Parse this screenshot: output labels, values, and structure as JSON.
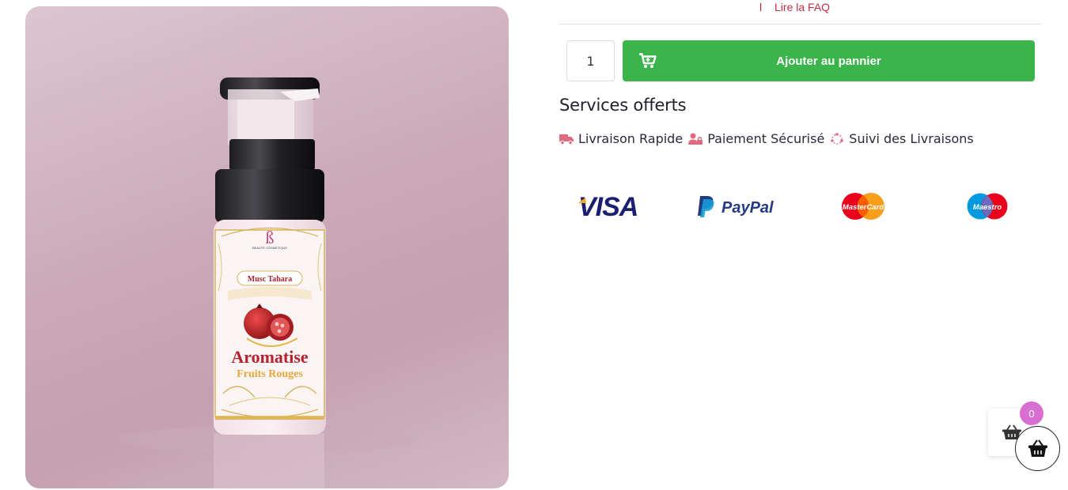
{
  "product": {
    "image_alt": "Musc Tahara Aromatise Fruits Rouges",
    "label_brand": "BEAUTE COSMETIQUE",
    "label_name": "Musc Tahara",
    "label_title": "Aromatise",
    "label_subtitle": "Fruits Rouges"
  },
  "faq": {
    "separator": "l",
    "link_label": "Lire la FAQ"
  },
  "cart_form": {
    "quantity": "1",
    "add_label": "Ajouter au pannier",
    "button_color": "#3ab44b"
  },
  "services": {
    "title": "Services offerts",
    "items": [
      {
        "label": "Livraison Rapide",
        "icon": "truck-icon"
      },
      {
        "label": "Paiement Sécurisé",
        "icon": "user-lock-icon"
      },
      {
        "label": "Suivi des Livraisons",
        "icon": "tracking-icon"
      }
    ],
    "icon_color": "#e06a7f"
  },
  "payments": [
    {
      "name": "VISA"
    },
    {
      "name": "PayPal"
    },
    {
      "name": "MasterCard"
    },
    {
      "name": "Maestro"
    }
  ],
  "floating_cart": {
    "count": "0",
    "badge_color": "#d86fd0"
  }
}
